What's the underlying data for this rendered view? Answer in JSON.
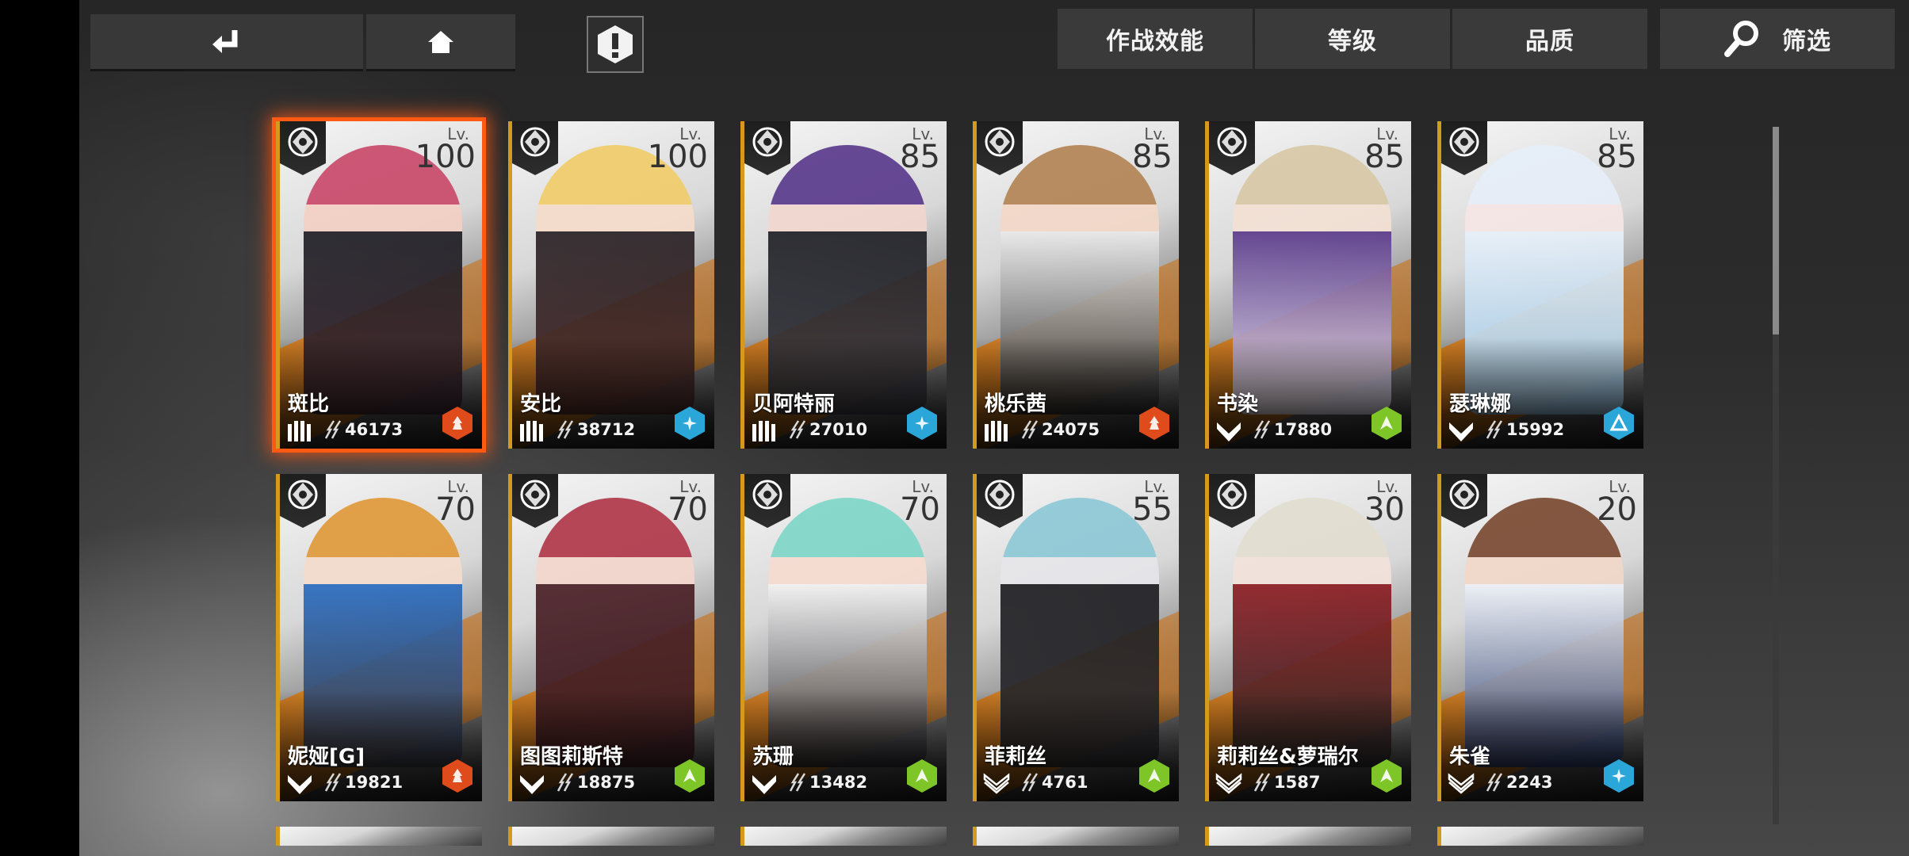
{
  "toolbar": {
    "sort_tabs": [
      "作战效能",
      "等级",
      "品质"
    ],
    "filter_label": "筛选"
  },
  "lv_prefix": "Lv.",
  "colors": {
    "selected_glow": "#ff5a14",
    "card_edge_gold": "#d49a1e",
    "element": {
      "fire": "#e04b1c",
      "ice": "#2aa7d8",
      "nature": "#7ec628",
      "physical": "#2aa7d8"
    }
  },
  "characters": [
    {
      "name": "斑比",
      "level": "100",
      "power": "46173",
      "element": "fire",
      "rank": "tower",
      "selected": true,
      "palette": [
        "#c94a6b",
        "#f3d0c4",
        "#1e1e24",
        "#3a2430"
      ]
    },
    {
      "name": "安比",
      "level": "100",
      "power": "38712",
      "element": "ice",
      "rank": "tower",
      "selected": false,
      "palette": [
        "#f0cc6a",
        "#f6dccb",
        "#2a2226",
        "#4a2a2a"
      ]
    },
    {
      "name": "贝阿特丽",
      "level": "85",
      "power": "27010",
      "element": "ice",
      "rank": "tower",
      "selected": false,
      "palette": [
        "#5a3a8c",
        "#f1d7cf",
        "#1f1f26",
        "#3b3b44"
      ]
    },
    {
      "name": "桃乐茜",
      "level": "85",
      "power": "24075",
      "element": "fire",
      "rank": "tower",
      "selected": false,
      "palette": [
        "#b38455",
        "#f3d8c8",
        "#eaeaea",
        "#2a2a2a"
      ]
    },
    {
      "name": "书染",
      "level": "85",
      "power": "17880",
      "element": "nature",
      "rank": "chevron",
      "selected": false,
      "palette": [
        "#d8c8a6",
        "#f3e0d4",
        "#5a3a8a",
        "#eeeaf6"
      ]
    },
    {
      "name": "瑟琳娜",
      "level": "85",
      "power": "15992",
      "element": "physical",
      "rank": "chevron",
      "selected": false,
      "palette": [
        "#e6eef8",
        "#f5e6e4",
        "#e8f0f8",
        "#9cc8e8"
      ]
    },
    {
      "name": "妮娅[G]",
      "level": "70",
      "power": "19821",
      "element": "fire",
      "rank": "chevron",
      "selected": false,
      "palette": [
        "#e09a3a",
        "#f3dccc",
        "#2a6cc0",
        "#3a3a44"
      ]
    },
    {
      "name": "图图莉斯特",
      "level": "70",
      "power": "18875",
      "element": "nature",
      "rank": "chevron",
      "selected": false,
      "palette": [
        "#b0384a",
        "#f3d6cc",
        "#4a2026",
        "#3a1a20"
      ]
    },
    {
      "name": "苏珊",
      "level": "70",
      "power": "13482",
      "element": "nature",
      "rank": "chevron",
      "selected": false,
      "palette": [
        "#7fd6c8",
        "#f6dcd0",
        "#f2f2f2",
        "#2a2a30"
      ]
    },
    {
      "name": "菲莉丝",
      "level": "55",
      "power": "4761",
      "element": "nature",
      "rank": "double",
      "selected": false,
      "palette": [
        "#8ec8d6",
        "#e6e6ea",
        "#1e1e22",
        "#2c2c30"
      ]
    },
    {
      "name": "莉莉丝&萝瑞尔",
      "level": "30",
      "power": "1587",
      "element": "nature",
      "rank": "double",
      "selected": false,
      "palette": [
        "#e2ddd0",
        "#f2e2da",
        "#8c1c22",
        "#2a2a2a"
      ]
    },
    {
      "name": "朱雀",
      "level": "20",
      "power": "2243",
      "element": "ice",
      "rank": "double",
      "selected": false,
      "palette": [
        "#7a4a32",
        "#f1d8c8",
        "#eef2f8",
        "#2a3a6a"
      ]
    }
  ],
  "partial_row_count": 6
}
